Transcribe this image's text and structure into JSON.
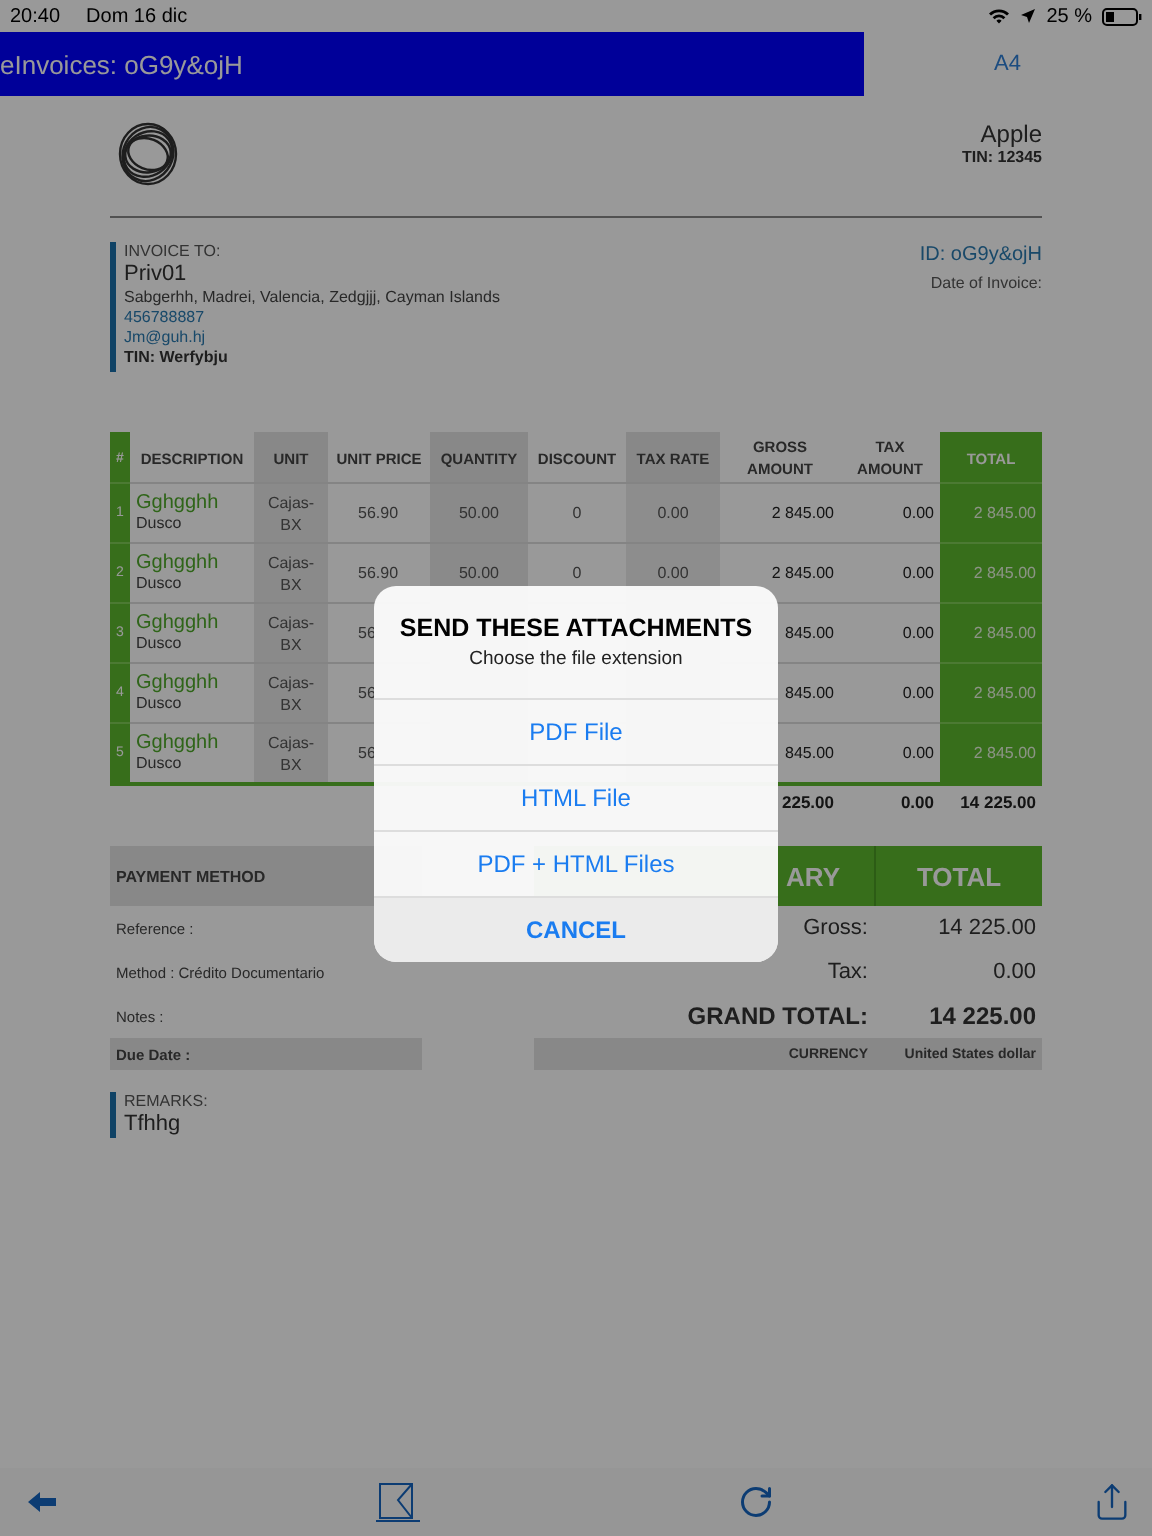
{
  "status_bar": {
    "time": "20:40",
    "date": "Dom 16 dic",
    "battery": "25 %"
  },
  "nav": {
    "title": "eInvoices: oG9y&ojH",
    "action": "A4"
  },
  "company": {
    "name": "Apple",
    "tin": "TIN: 12345"
  },
  "invoice_to": {
    "label": "INVOICE TO:",
    "name": "Priv01",
    "address": "Sabgerhh, Madrei, Valencia, Zedgjjj, Cayman Islands",
    "phone": "456788887",
    "email": "Jm@guh.hj",
    "tin": "TIN: Werfybju"
  },
  "invoice_meta": {
    "id": "ID: oG9y&ojH",
    "date_label": "Date of Invoice:"
  },
  "table": {
    "columns": [
      "#",
      "DESCRIPTION",
      "UNIT",
      "UNIT PRICE",
      "QUANTITY",
      "DISCOUNT",
      "TAX RATE",
      "GROSS AMOUNT",
      "TAX AMOUNT",
      "TOTAL"
    ],
    "rows": [
      {
        "num": "1",
        "description": "Gghgghh",
        "detail": "Dusco",
        "unit": "Cajas-BX",
        "unit_price": "56.90",
        "quantity": "50.00",
        "discount": "0",
        "tax_rate": "0.00",
        "gross": "2 845.00",
        "tax_amount": "0.00",
        "total": "2 845.00"
      },
      {
        "num": "2",
        "description": "Gghgghh",
        "detail": "Dusco",
        "unit": "Cajas-BX",
        "unit_price": "56.90",
        "quantity": "50.00",
        "discount": "0",
        "tax_rate": "0.00",
        "gross": "2 845.00",
        "tax_amount": "0.00",
        "total": "2 845.00"
      },
      {
        "num": "3",
        "description": "Gghgghh",
        "detail": "Dusco",
        "unit": "Cajas-BX",
        "unit_price": "56",
        "gross": "845.00",
        "tax_amount": "0.00",
        "total": "2 845.00"
      },
      {
        "num": "4",
        "description": "Gghgghh",
        "detail": "Dusco",
        "unit": "Cajas-BX",
        "unit_price": "56",
        "gross": "845.00",
        "tax_amount": "0.00",
        "total": "2 845.00"
      },
      {
        "num": "5",
        "description": "Gghgghh",
        "detail": "Dusco",
        "unit": "Cajas-BX",
        "unit_price": "56",
        "gross": "845.00",
        "tax_amount": "0.00",
        "total": "2 845.00"
      }
    ],
    "totals": {
      "gross": "225.00",
      "tax_amount": "0.00",
      "total": "14 225.00"
    }
  },
  "payment": {
    "header": "PAYMENT METHOD",
    "lines": [
      "Reference :",
      "Method : Crédito Documentario",
      "Notes :"
    ],
    "due_date": "Due Date :"
  },
  "summary": {
    "header": "ARY",
    "total_header": "TOTAL",
    "lines": [
      {
        "kind": "plain",
        "label": "Gross:",
        "value": "14 225.00"
      },
      {
        "kind": "plain",
        "label": "Tax:",
        "value": "0.00"
      },
      {
        "kind": "grand",
        "label": "GRAND TOTAL:",
        "value": "14 225.00"
      }
    ],
    "currency_label": "CURRENCY",
    "currency": "United States dollar"
  },
  "remarks": {
    "label": "REMARKS:",
    "text": "Tfhhg"
  },
  "dialog": {
    "title": "SEND THESE ATTACHMENTS",
    "subtitle": "Choose the file extension",
    "options": [
      {
        "kind": "option",
        "label": "PDF File"
      },
      {
        "kind": "option",
        "label": "HTML File"
      },
      {
        "kind": "option",
        "label": "PDF + HTML Files"
      },
      {
        "kind": "cancel",
        "label": "CANCEL"
      }
    ]
  }
}
